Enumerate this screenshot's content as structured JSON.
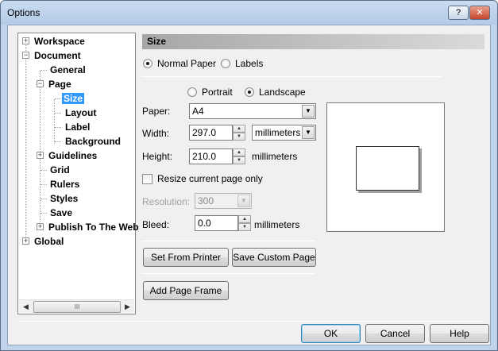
{
  "window": {
    "title": "Options",
    "help_label": "?",
    "close_label": "✕"
  },
  "tree": {
    "items": [
      {
        "label": "Workspace",
        "expander": "+"
      },
      {
        "label": "Document",
        "expander": "−"
      },
      {
        "label": "General"
      },
      {
        "label": "Page",
        "expander": "−"
      },
      {
        "label": "Size",
        "selected": true
      },
      {
        "label": "Layout"
      },
      {
        "label": "Label"
      },
      {
        "label": "Background"
      },
      {
        "label": "Guidelines",
        "expander": "+"
      },
      {
        "label": "Grid"
      },
      {
        "label": "Rulers"
      },
      {
        "label": "Styles"
      },
      {
        "label": "Save"
      },
      {
        "label": "Publish To The Web",
        "expander": "+"
      },
      {
        "label": "Global",
        "expander": "+"
      }
    ],
    "scroll_left": "◀",
    "scroll_right": "▶",
    "scroll_grip": "III"
  },
  "panel": {
    "header": "Size",
    "paper_type": {
      "normal_label": "Normal Paper",
      "labels_label": "Labels",
      "selected": "normal"
    },
    "orientation": {
      "portrait_label": "Portrait",
      "landscape_label": "Landscape",
      "selected": "landscape"
    },
    "paper_label": "Paper:",
    "paper_value": "A4",
    "width_label": "Width:",
    "width_value": "297.0",
    "width_unit": "millimeters",
    "height_label": "Height:",
    "height_value": "210.0",
    "height_unit": "millimeters",
    "resize_label": "Resize current page only",
    "resolution_label": "Resolution:",
    "resolution_value": "300",
    "bleed_label": "Bleed:",
    "bleed_value": "0.0",
    "bleed_unit": "millimeters",
    "set_from_printer": "Set From Printer",
    "save_custom_page": "Save Custom Page",
    "add_page_frame": "Add Page Frame"
  },
  "footer": {
    "ok": "OK",
    "cancel": "Cancel",
    "help": "Help"
  },
  "glyphs": {
    "dropdown": "▼",
    "spin_up": "▲",
    "spin_down": "▼"
  }
}
